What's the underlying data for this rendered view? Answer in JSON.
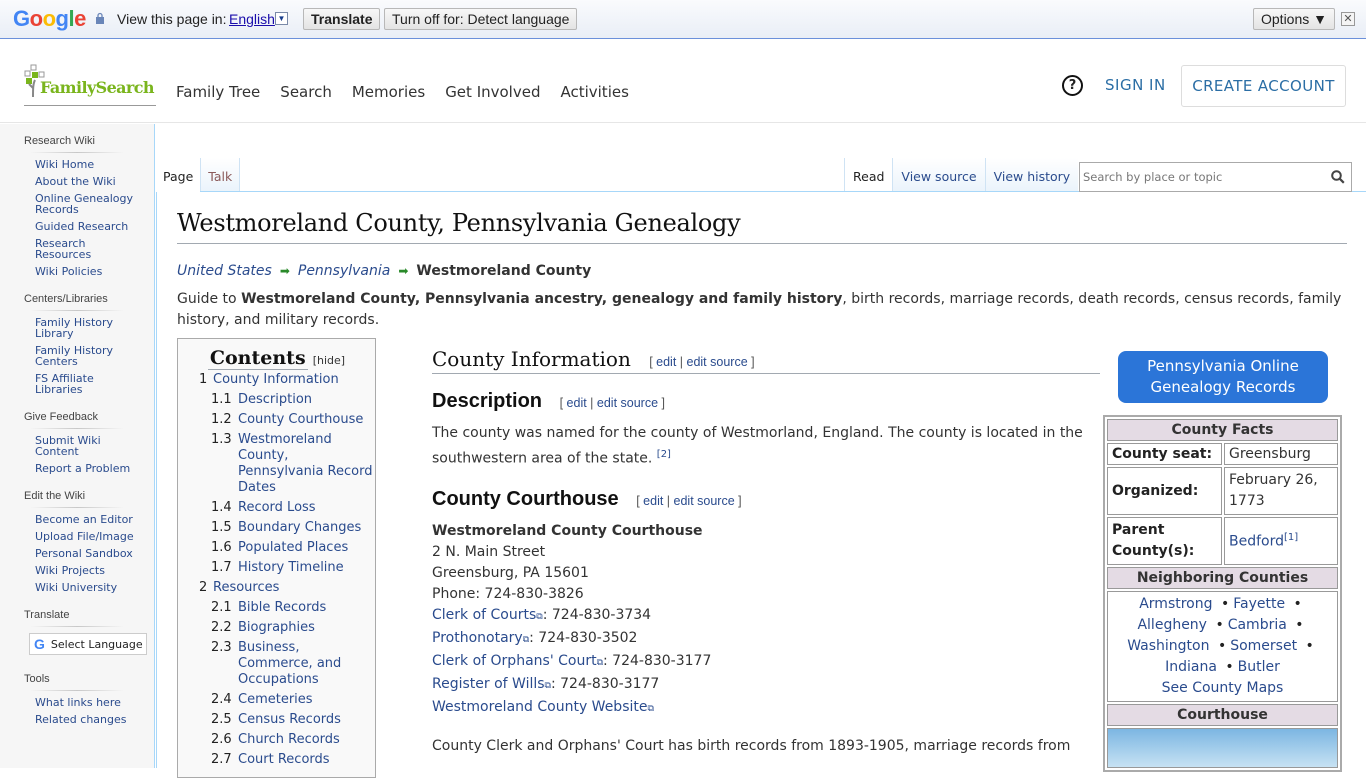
{
  "translate_bar": {
    "brand": "Google",
    "view_in_label": "View this page in:",
    "language": "English",
    "translate_button": "Translate",
    "turn_off_button": "Turn off for: Detect language",
    "options_button": "Options ▼",
    "close_symbol": "✕"
  },
  "header": {
    "logo_text": "FamilySearch",
    "nav": [
      "Family Tree",
      "Search",
      "Memories",
      "Get Involved",
      "Activities"
    ],
    "help_symbol": "?",
    "sign_in": "SIGN IN",
    "create_account": "CREATE ACCOUNT"
  },
  "sidebar": {
    "sections": [
      {
        "title": "Research Wiki",
        "items": [
          "Wiki Home",
          "About the Wiki",
          "Online Genealogy Records",
          "Guided Research",
          "Research Resources",
          "Wiki Policies"
        ]
      },
      {
        "title": "Centers/Libraries",
        "items": [
          "Family History Library",
          "Family History Centers",
          "FS Affiliate Libraries"
        ]
      },
      {
        "title": "Give Feedback",
        "items": [
          "Submit Wiki Content",
          "Report a Problem"
        ]
      },
      {
        "title": "Edit the Wiki",
        "items": [
          "Become an Editor",
          "Upload File/Image",
          "Personal Sandbox",
          "Wiki Projects",
          "Wiki University"
        ]
      }
    ],
    "translate": {
      "title": "Translate",
      "select_label": "Select Language"
    },
    "tools": {
      "title": "Tools",
      "items": [
        "What links here",
        "Related changes"
      ]
    }
  },
  "tabs": {
    "left": [
      "Page",
      "Talk"
    ],
    "right": [
      "Read",
      "View source",
      "View history"
    ],
    "search_placeholder": "Search by place or topic"
  },
  "page": {
    "title": "Westmoreland County, Pennsylvania Genealogy",
    "breadcrumb": [
      "United States",
      "Pennsylvania",
      "Westmoreland County"
    ],
    "intro_prefix": "Guide to ",
    "intro_bold": "Westmoreland County, Pennsylvania ancestry, genealogy and family history",
    "intro_suffix": ", birth records, marriage records, death records, census records, family history, and military records."
  },
  "toc": {
    "title": "Contents",
    "hide": "[hide]",
    "entries": [
      {
        "num": "1",
        "text": "County Information",
        "level": 1
      },
      {
        "num": "1.1",
        "text": "Description",
        "level": 2
      },
      {
        "num": "1.2",
        "text": "County Courthouse",
        "level": 2
      },
      {
        "num": "1.3",
        "text": "Westmoreland County, Pennsylvania Record Dates",
        "level": 2
      },
      {
        "num": "1.4",
        "text": "Record Loss",
        "level": 2
      },
      {
        "num": "1.5",
        "text": "Boundary Changes",
        "level": 2
      },
      {
        "num": "1.6",
        "text": "Populated Places",
        "level": 2
      },
      {
        "num": "1.7",
        "text": "History Timeline",
        "level": 2
      },
      {
        "num": "2",
        "text": "Resources",
        "level": 1
      },
      {
        "num": "2.1",
        "text": "Bible Records",
        "level": 2
      },
      {
        "num": "2.2",
        "text": "Biographies",
        "level": 2
      },
      {
        "num": "2.3",
        "text": "Business, Commerce, and Occupations",
        "level": 2
      },
      {
        "num": "2.4",
        "text": "Cemeteries",
        "level": 2
      },
      {
        "num": "2.5",
        "text": "Census Records",
        "level": 2
      },
      {
        "num": "2.6",
        "text": "Church Records",
        "level": 2
      },
      {
        "num": "2.7",
        "text": "Court Records",
        "level": 2
      }
    ]
  },
  "sections": {
    "edit": "edit",
    "edit_source": "edit source",
    "county_info": "County Information",
    "description": {
      "heading": "Description",
      "text": "The county was named for the county of Westmorland, England. The county is located in the southwestern area of the state.",
      "ref": "[2]"
    },
    "courthouse": {
      "heading": "County Courthouse",
      "name": "Westmoreland County Courthouse",
      "address1": "2 N. Main Street",
      "address2": "Greensburg, PA 15601",
      "phone": "Phone: 724-830-3826",
      "links": [
        {
          "label": "Clerk of Courts",
          "phone": ": 724-830-3734"
        },
        {
          "label": "Prothonotary",
          "phone": ": 724-830-3502"
        },
        {
          "label": "Clerk of Orphans' Court",
          "phone": ": 724-830-3177"
        },
        {
          "label": "Register of Wills",
          "phone": ": 724-830-3177"
        },
        {
          "label": "Westmoreland County Website",
          "phone": ""
        }
      ],
      "records_text": "County Clerk and Orphans' Court has birth records from 1893-1905, marriage records from"
    }
  },
  "infobox": {
    "button": "Pennsylvania Online Genealogy Records",
    "facts_title": "County Facts",
    "seat_label": "County seat:",
    "seat": "Greensburg",
    "organized_label": "Organized:",
    "organized": "February 26, 1773",
    "parent_label": "Parent County(s):",
    "parent": "Bedford",
    "parent_ref": "[1]",
    "neighbors_title": "Neighboring Counties",
    "neighbors": [
      "Armstrong",
      "Fayette",
      "Allegheny",
      "Cambria",
      "Washington",
      "Somerset",
      "Indiana",
      "Butler"
    ],
    "maps_link": "See County Maps",
    "courthouse_title": "Courthouse",
    "bullet": "•"
  },
  "colors": {
    "link": "#2a4b8d",
    "brand_green": "#7ab51d",
    "button_blue": "#2b75d8",
    "infobox_header": "#e4dbe4"
  }
}
